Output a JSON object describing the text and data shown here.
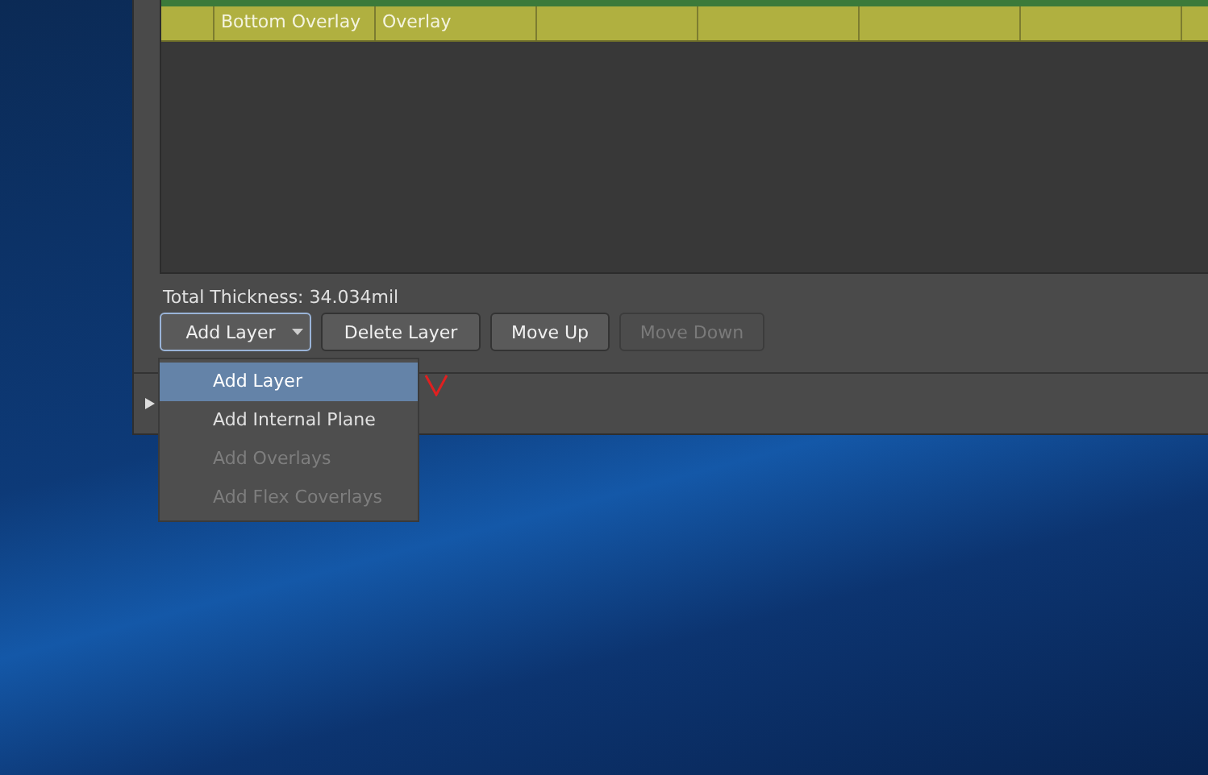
{
  "table": {
    "rows": [
      {
        "name": "Bottom Overlay",
        "material": "Overlay"
      }
    ]
  },
  "total_thickness": "Total Thickness: 34.034mil",
  "buttons": [
    {
      "label": "Add Layer",
      "kind": "dropdown",
      "disabled": false,
      "focused": true
    },
    {
      "label": "Delete Layer",
      "kind": "plain",
      "disabled": false,
      "focused": false
    },
    {
      "label": "Move Up",
      "kind": "plain",
      "disabled": false,
      "focused": false
    },
    {
      "label": "Move Down",
      "kind": "plain",
      "disabled": true,
      "focused": false
    }
  ],
  "menu": {
    "items": [
      {
        "label": "Add Layer",
        "selected": true,
        "disabled": false
      },
      {
        "label": "Add Internal Plane",
        "selected": false,
        "disabled": false
      },
      {
        "label": "Add Overlays",
        "selected": false,
        "disabled": true
      },
      {
        "label": "Add Flex Coverlays",
        "selected": false,
        "disabled": true
      }
    ]
  }
}
